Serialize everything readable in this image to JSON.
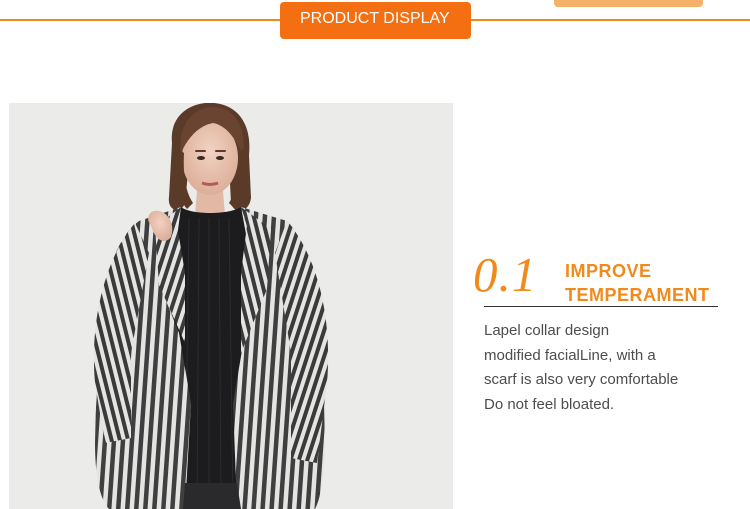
{
  "header": {
    "section_label": "PRODUCT DISPLAY",
    "accent_color": "#f36f11",
    "line_color": "#f08a1c"
  },
  "feature": {
    "number": "0.1",
    "title_lines": [
      "IMPROVE",
      "TEMPERAMENT"
    ],
    "description_lines": [
      "Lapel collar design",
      "modified facialLine, with a",
      "scarf is also very comfortable",
      "Do not feel bloated."
    ],
    "accent_color": "#f08a1c"
  },
  "photo": {
    "subject": "model-in-striped-coat"
  }
}
